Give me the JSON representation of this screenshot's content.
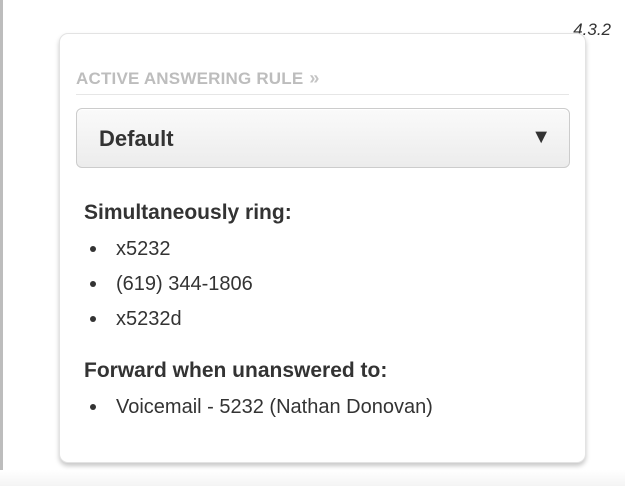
{
  "version_label": "4.3.2",
  "card": {
    "header_label": "ACTIVE ANSWERING RULE",
    "header_chevron": "»",
    "selected_rule": "Default",
    "caret_icon": "▼",
    "simultaneous": {
      "title": "Simultaneously ring:",
      "items": [
        "x5232",
        "(619) 344-1806",
        "x5232d"
      ]
    },
    "forward": {
      "title": "Forward when unanswered to:",
      "items": [
        "Voicemail - 5232 (Nathan Donovan)"
      ]
    }
  },
  "colors": {
    "header_text": "#bdbdbd",
    "body_text": "#333333",
    "card_border": "#e3e3e3"
  }
}
